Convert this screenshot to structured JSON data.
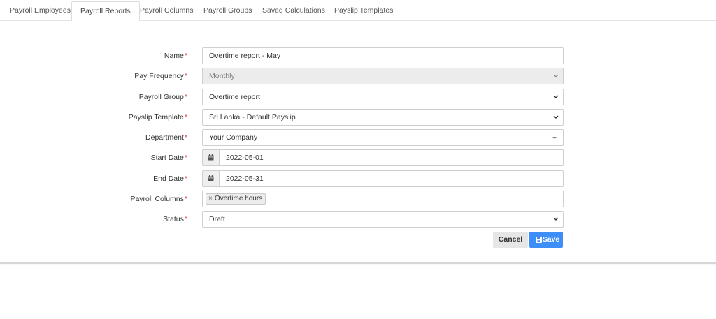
{
  "tabs": [
    {
      "label": "Payroll Employees"
    },
    {
      "label": "Payroll Reports"
    },
    {
      "label": "Payroll Columns"
    },
    {
      "label": "Payroll Groups"
    },
    {
      "label": "Saved Calculations"
    },
    {
      "label": "Payslip Templates"
    }
  ],
  "form": {
    "required_mark": "*",
    "name": {
      "label": "Name",
      "value": "Overtime report - May"
    },
    "pay_frequency": {
      "label": "Pay Frequency",
      "value": "Monthly"
    },
    "payroll_group": {
      "label": "Payroll Group",
      "value": "Overtime report"
    },
    "payslip_template": {
      "label": "Payslip Template",
      "value": "Sri Lanka - Default Payslip"
    },
    "department": {
      "label": "Department",
      "value": "Your Company"
    },
    "start_date": {
      "label": "Start Date",
      "value": "2022-05-01"
    },
    "end_date": {
      "label": "End Date",
      "value": "2022-05-31"
    },
    "payroll_columns": {
      "label": "Payroll Columns",
      "remove_glyph": "×",
      "tags": [
        "Overtime hours"
      ]
    },
    "status": {
      "label": "Status",
      "value": "Draft"
    }
  },
  "buttons": {
    "cancel": "Cancel",
    "save": "Save"
  },
  "colors": {
    "accent": "#3e8ef7",
    "required": "#d43f3a"
  },
  "icons": {
    "date_addon": "calendar-icon",
    "save": "floppy-disk-icon",
    "select": "chevron-down-icon"
  }
}
